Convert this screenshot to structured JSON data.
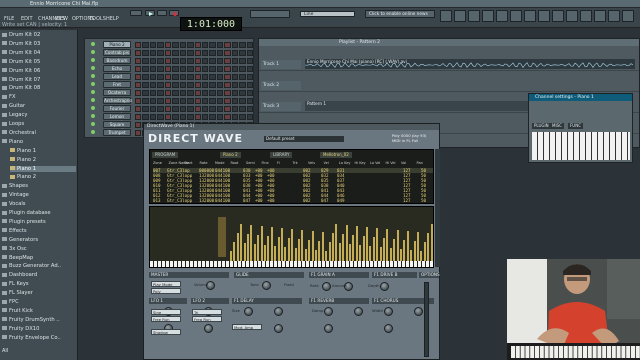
{
  "app": {
    "window_title": "Ennio Morricone Chi Mai.flp",
    "hint_line": "Write set CAN | velocity: 1",
    "tempo_display": "1:01:000",
    "pattern_label": "Line",
    "hint_box": "Click to enable online news"
  },
  "menu": [
    "FILE",
    "EDIT",
    "CHANNELS",
    "VIEW",
    "OPTIONS",
    "TOOLS",
    "HELP"
  ],
  "browser": {
    "items": [
      {
        "label": "Drum Kit 02",
        "type": "folder"
      },
      {
        "label": "Drum Kit 03",
        "type": "folder"
      },
      {
        "label": "Drum Kit 04",
        "type": "folder"
      },
      {
        "label": "Drum Kit 05",
        "type": "folder"
      },
      {
        "label": "Drum Kit 06",
        "type": "folder"
      },
      {
        "label": "Drum Kit 07",
        "type": "folder"
      },
      {
        "label": "Drum Kit 08",
        "type": "folder"
      },
      {
        "label": "FX",
        "type": "folder"
      },
      {
        "label": "Guitar",
        "type": "folder"
      },
      {
        "label": "Legacy",
        "type": "folder"
      },
      {
        "label": "Loops",
        "type": "folder"
      },
      {
        "label": "Orchestral",
        "type": "folder"
      },
      {
        "label": "Piano",
        "type": "folder"
      },
      {
        "label": "Piano 1",
        "type": "file"
      },
      {
        "label": "Piano 2",
        "type": "file"
      },
      {
        "label": "Piano 1",
        "type": "file",
        "selected": true
      },
      {
        "label": "Piano 2",
        "type": "file"
      },
      {
        "label": "Shapes",
        "type": "folder"
      },
      {
        "label": "Vintage",
        "type": "folder"
      },
      {
        "label": "Vocals",
        "type": "folder"
      },
      {
        "label": "Plugin database",
        "type": "folder"
      },
      {
        "label": "Plugin presets",
        "type": "folder"
      },
      {
        "label": "Effects",
        "type": "folder"
      },
      {
        "label": "Generators",
        "type": "folder"
      },
      {
        "label": "3x Osc",
        "type": "folder"
      },
      {
        "label": "BeepMap",
        "type": "folder"
      },
      {
        "label": "Buzz Generator Ad..",
        "type": "folder"
      },
      {
        "label": "Dashboard",
        "type": "folder"
      },
      {
        "label": "FL Keys",
        "type": "folder"
      },
      {
        "label": "FL Slayer",
        "type": "folder"
      },
      {
        "label": "FPC",
        "type": "folder"
      },
      {
        "label": "Fruit Kick",
        "type": "folder"
      },
      {
        "label": "Fruity DrumSynth ..",
        "type": "folder"
      },
      {
        "label": "Fruity DX10",
        "type": "folder"
      },
      {
        "label": "Fruity Envelope Co..",
        "type": "folder"
      }
    ],
    "all_label": "All"
  },
  "channel_rack": {
    "channels": [
      {
        "name": "Piano 2",
        "active": true
      },
      {
        "name": "Contrab pis"
      },
      {
        "name": "Bassdrum"
      },
      {
        "name": "Echo bordon"
      },
      {
        "name": "Lead"
      },
      {
        "name": "Fret"
      },
      {
        "name": "Ocaterra"
      },
      {
        "name": "Archestrapno"
      },
      {
        "name": "Fourier sounde"
      },
      {
        "name": "Lemon sounde"
      },
      {
        "name": "Square puncti"
      },
      {
        "name": "Trumpet"
      },
      {
        "name": "Flanger puncs"
      },
      {
        "name": "Seraphim"
      },
      {
        "name": "Violins"
      },
      {
        "name": "Sine drone"
      },
      {
        "name": "Rapper bass"
      },
      {
        "name": "Noise ensemb"
      },
      {
        "name": "Noise strings"
      },
      {
        "name": "Goodboy"
      },
      {
        "name": "Clock"
      },
      {
        "name": "Flanger2"
      },
      {
        "name": "Bamboo"
      },
      {
        "name": "Broker"
      }
    ]
  },
  "playlist": {
    "title": "Playlist - Pattern 2",
    "tracks": [
      {
        "name": "Track 1",
        "clip": "Ennio Morricone Chi Mai (piano) [RC] (.WAV).avi"
      },
      {
        "name": "Track 2",
        "clip": ""
      },
      {
        "name": "Track 3",
        "clip": "Pattern 1"
      },
      {
        "name": "Track 4",
        "clip": ""
      }
    ]
  },
  "direct_wave": {
    "window_title": "DirectWave (Piano 1)",
    "logo": "DIRECT WAVE",
    "preset_label": "Default preset",
    "info": "Poly 0000 (lay 93) MIDI in FL Full",
    "program_tab": "PROGRAM",
    "program_name": "Piano 2",
    "library_tab": "LIBRARY",
    "library_name": "Mellotron_02",
    "columns": [
      "Zone",
      "Zone Name",
      "Start",
      "Rate",
      "Mode",
      "Root",
      "Semi",
      "Fine",
      "Fi",
      "Trk",
      "Vels",
      "Vel",
      "Lo Key",
      "Hi Key",
      "Lo Vel",
      "Hi Vel",
      "Vol",
      "Pan"
    ],
    "zones": [
      {
        "n": "007",
        "name": "Gtr_C3lop",
        "start": "000000",
        "rate": "044100",
        "root": "030",
        "semi": "+00",
        "fine": "+00",
        "vel": "002",
        "lo": "029",
        "hi": "031",
        "vol": "127",
        "pan": "50"
      },
      {
        "n": "008",
        "name": "Gtr_C3lopp",
        "start": "132000",
        "rate": "044100",
        "root": "033",
        "semi": "+00",
        "fine": "+00",
        "vel": "002",
        "lo": "032",
        "hi": "034",
        "vol": "127",
        "pan": "50"
      },
      {
        "n": "009",
        "name": "Gtr_C3lopp",
        "start": "132000",
        "rate": "044100",
        "root": "035",
        "semi": "+00",
        "fine": "+00",
        "vel": "002",
        "lo": "035",
        "hi": "037",
        "vol": "127",
        "pan": "50"
      },
      {
        "n": "010",
        "name": "Gtr_C3lopp",
        "start": "132000",
        "rate": "044100",
        "root": "038",
        "semi": "+00",
        "fine": "+00",
        "vel": "002",
        "lo": "038",
        "hi": "040",
        "vol": "127",
        "pan": "50"
      },
      {
        "n": "011",
        "name": "Gtr_C3lopp",
        "start": "132000",
        "rate": "044100",
        "root": "041",
        "semi": "+00",
        "fine": "+00",
        "vel": "002",
        "lo": "041",
        "hi": "043",
        "vol": "127",
        "pan": "50"
      },
      {
        "n": "012",
        "name": "Gtr_C3lopp",
        "start": "132000",
        "rate": "044100",
        "root": "044",
        "semi": "+00",
        "fine": "+00",
        "vel": "002",
        "lo": "044",
        "hi": "046",
        "vol": "127",
        "pan": "50"
      },
      {
        "n": "013",
        "name": "Gtr_C3lopp",
        "start": "132000",
        "rate": "044100",
        "root": "047",
        "semi": "+00",
        "fine": "+00",
        "vel": "002",
        "lo": "047",
        "hi": "049",
        "vol": "127",
        "pan": "50"
      }
    ],
    "sections": [
      "MASTER",
      "GLIDE",
      "F1 GRAIN A",
      "F1 DRIVE B",
      "OPTIONS",
      "LFO 1",
      "LFO 2",
      "F1 DELAY",
      "F1 REVERB",
      "F1 CHORUS"
    ],
    "knob_labels": [
      "Volume",
      "Tone",
      "Rate",
      "Depth",
      "Amount",
      "Mix",
      "Time",
      "Size",
      "Damp",
      "Width"
    ],
    "fields": [
      "Play Mode",
      "Poly",
      "Sine",
      "Tri",
      "Free Run",
      "Freq Run",
      "Mod: Amp",
      "Shadow"
    ],
    "checkbox_label": "Fixed"
  },
  "channel_settings": {
    "title": "Channel settings - Piano 1",
    "tabs": [
      "PLUGIN",
      "MISC",
      "FUNC"
    ]
  }
}
